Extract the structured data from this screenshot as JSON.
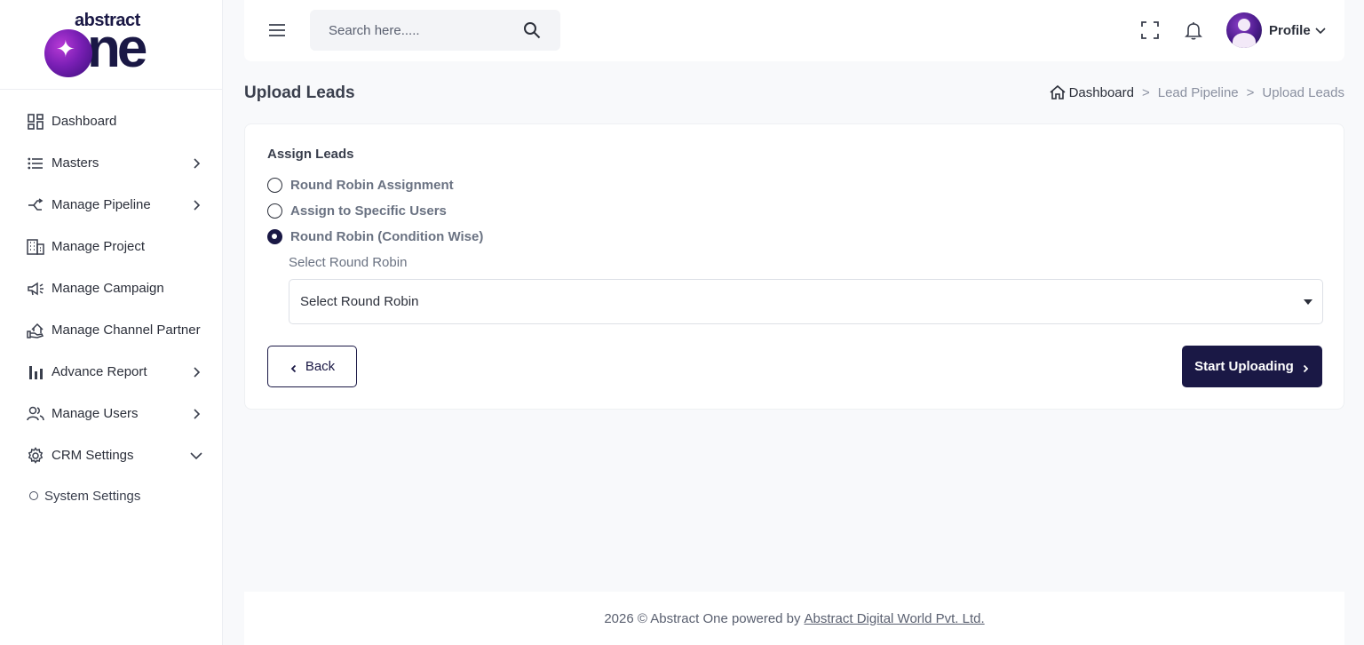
{
  "brand": {
    "logo_top": "abstract",
    "logo_main": "ne"
  },
  "sidebar": {
    "items": [
      {
        "label": "Dashboard",
        "icon": "dashboard-grid-icon",
        "has_arrow": false
      },
      {
        "label": "Masters",
        "icon": "list-icon",
        "has_arrow": true
      },
      {
        "label": "Manage Pipeline",
        "icon": "pipeline-icon",
        "has_arrow": true
      },
      {
        "label": "Manage Project",
        "icon": "building-icon",
        "has_arrow": false
      },
      {
        "label": "Manage Campaign",
        "icon": "megaphone-icon",
        "has_arrow": false
      },
      {
        "label": "Manage Channel Partner",
        "icon": "handshake-home-icon",
        "has_arrow": false
      },
      {
        "label": "Advance Report",
        "icon": "bar-chart-icon",
        "has_arrow": true
      },
      {
        "label": "Manage Users",
        "icon": "users-icon",
        "has_arrow": true
      },
      {
        "label": "CRM Settings",
        "icon": "gear-icon",
        "has_arrow": "down"
      }
    ],
    "sub_items": [
      {
        "label": "System Settings"
      }
    ]
  },
  "header": {
    "search_placeholder": "Search here.....",
    "profile_label": "Profile"
  },
  "page": {
    "title": "Upload Leads",
    "breadcrumb": {
      "home": "Dashboard",
      "middle": "Lead Pipeline",
      "current": "Upload Leads",
      "separator": ">"
    }
  },
  "form": {
    "section_label": "Assign Leads",
    "options": [
      {
        "label": "Round Robin Assignment",
        "checked": false
      },
      {
        "label": "Assign to Specific Users",
        "checked": false
      },
      {
        "label": "Round Robin (Condition Wise)",
        "checked": true
      }
    ],
    "select_label": "Select Round Robin",
    "select_value": "Select Round Robin",
    "back_label": "Back",
    "start_label": "Start Uploading"
  },
  "footer": {
    "text": "2026 © Abstract One powered by",
    "link": "Abstract Digital World Pvt. Ltd."
  },
  "colors": {
    "primary": "#1a1845",
    "sidebar_bg": "#ffffff",
    "page_bg": "#f8f9fb",
    "muted_text": "#6a7282"
  }
}
